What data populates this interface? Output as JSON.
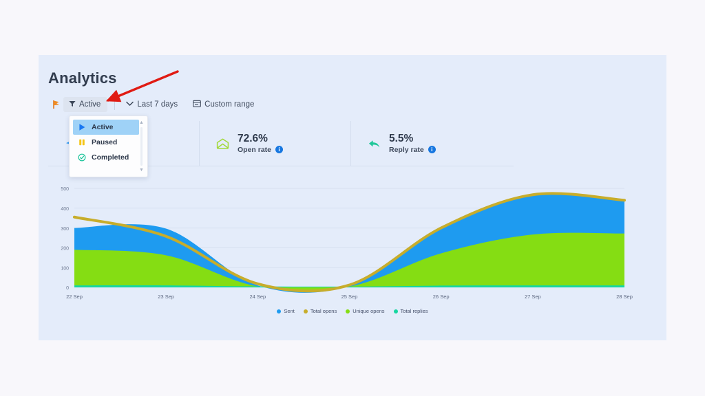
{
  "header": {
    "title": "Analytics"
  },
  "toolbar": {
    "flag_icon": "flag-icon",
    "filter": {
      "icon": "funnel-icon",
      "label": "Active"
    },
    "range": {
      "icon": "chevron-down-icon",
      "label": "Last 7 days"
    },
    "custom": {
      "icon": "calendar-icon",
      "label": "Custom range"
    }
  },
  "dropdown": {
    "options": [
      {
        "label": "Active",
        "icon": "play-icon",
        "color": "#1877f2",
        "selected": true
      },
      {
        "label": "Paused",
        "icon": "pause-icon",
        "color": "#f5c518",
        "selected": false
      },
      {
        "label": "Completed",
        "icon": "check-circle-icon",
        "color": "#13c296",
        "selected": false
      }
    ],
    "scroll_up": "▲",
    "scroll_down": "▼"
  },
  "stats": [
    {
      "icon": "send-icon",
      "value": "",
      "label": "",
      "has_info": false
    },
    {
      "icon": "open-envelope-icon",
      "value": "72.6%",
      "label": "Open rate",
      "has_info": true,
      "info": "i"
    },
    {
      "icon": "reply-arrow-icon",
      "value": "5.5%",
      "label": "Reply rate",
      "has_info": true,
      "info": "i"
    }
  ],
  "colors": {
    "page_bg": "#f8f7fb",
    "panel_bg": "#e4ecfa",
    "sent": "#1e9bf0",
    "total_opens": "#c7ad2b",
    "unique_opens": "#85dd13",
    "total_replies": "#16d7a0",
    "accent_blue": "#1777e0",
    "annotation_arrow": "#e01b13"
  },
  "chart_data": {
    "type": "area",
    "title": "",
    "xlabel": "",
    "ylabel": "",
    "grid": true,
    "legend_position": "bottom",
    "ylim": [
      0,
      500
    ],
    "yticks": [
      0,
      100,
      200,
      300,
      400,
      500
    ],
    "categories": [
      "22 Sep",
      "23 Sep",
      "24 Sep",
      "25 Sep",
      "26 Sep",
      "27 Sep",
      "28 Sep"
    ],
    "x": [
      "22 Sep",
      "23 Sep",
      "24 Sep",
      "25 Sep",
      "26 Sep",
      "27 Sep",
      "28 Sep"
    ],
    "stacked": true,
    "series": [
      {
        "name": "Sent",
        "color": "#1e9bf0",
        "values": [
          300,
          297,
          10,
          8,
          300,
          470,
          445
        ]
      },
      {
        "name": "Total opens",
        "color": "#c7ad2b",
        "values": [
          355,
          258,
          18,
          12,
          300,
          468,
          440
        ]
      },
      {
        "name": "Unique opens",
        "color": "#85dd13",
        "values": [
          190,
          162,
          5,
          4,
          172,
          267,
          272
        ]
      },
      {
        "name": "Total replies",
        "color": "#16d7a0",
        "values": [
          10,
          10,
          5,
          4,
          9,
          10,
          10
        ]
      }
    ],
    "legend": [
      "Sent",
      "Total opens",
      "Unique opens",
      "Total replies"
    ]
  }
}
